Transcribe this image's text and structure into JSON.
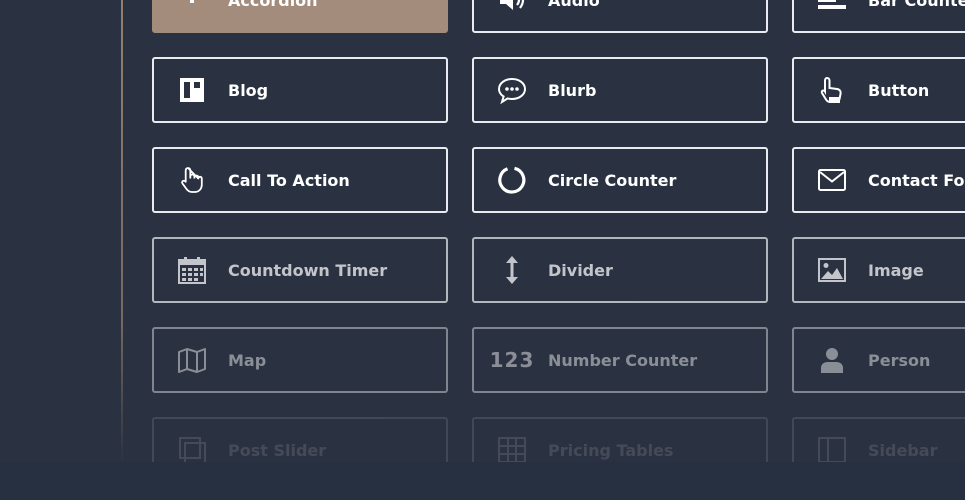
{
  "modules": {
    "accordion": "Accordion",
    "audio": "Audio",
    "bar_counters": "Bar Counters",
    "blog": "Blog",
    "blurb": "Blurb",
    "button": "Button",
    "call_to_action": "Call To Action",
    "circle_counter": "Circle Counter",
    "contact_form": "Contact Form",
    "countdown_timer": "Countdown Timer",
    "divider": "Divider",
    "image": "Image",
    "map": "Map",
    "number_counter": "Number Counter",
    "number_counter_icon": "123",
    "person": "Person",
    "post_slider": "Post Slider",
    "pricing_tables": "Pricing Tables",
    "sidebar": "Sidebar"
  },
  "icons": {
    "accordion": "accordion-icon",
    "audio": "speaker-icon",
    "bar_counters": "bar-counters-icon",
    "blog": "blog-layout-icon",
    "blurb": "speech-bubble-icon",
    "button": "pointing-hand-icon",
    "call_to_action": "hand-pointer-icon",
    "circle_counter": "circle-counter-icon",
    "contact_form": "envelope-icon",
    "countdown_timer": "calendar-icon",
    "divider": "vertical-arrows-icon",
    "image": "image-icon",
    "map": "map-icon",
    "person": "person-icon",
    "post_slider": "post-slider-icon",
    "pricing_tables": "table-grid-icon",
    "sidebar": "sidebar-layout-icon"
  },
  "colors": {
    "background": "#2a3141",
    "border": "#e8ebef",
    "active_fill": "#a48c7c",
    "text": "#ffffff"
  }
}
